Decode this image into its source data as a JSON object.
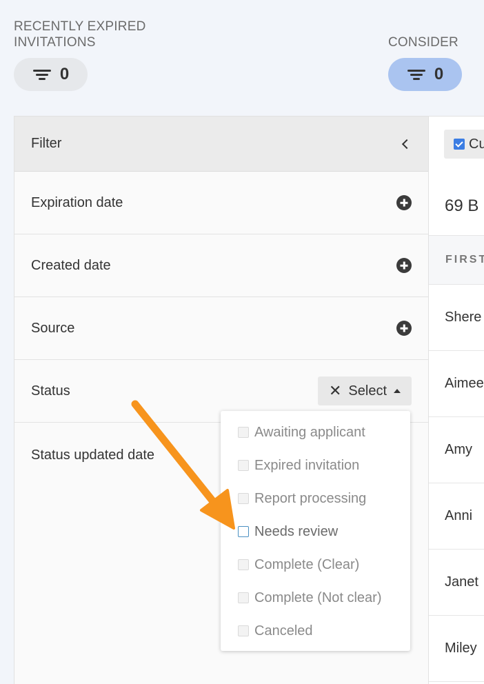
{
  "stats": [
    {
      "label": "RECENTLY EXPIRED INVITATIONS",
      "count": "0"
    },
    {
      "label": "CONSIDER",
      "count": "0"
    }
  ],
  "filter": {
    "title": "Filter",
    "rows": [
      {
        "label": "Expiration date"
      },
      {
        "label": "Created date"
      },
      {
        "label": "Source"
      },
      {
        "label": "Status",
        "select_label": "Select"
      },
      {
        "label": "Status updated date"
      }
    ]
  },
  "status_dropdown": {
    "options": [
      {
        "label": "Awaiting applicant",
        "checked": false
      },
      {
        "label": "Expired invitation",
        "checked": false
      },
      {
        "label": "Report processing",
        "checked": false
      },
      {
        "label": "Needs review",
        "checked": false
      },
      {
        "label": "Complete (Clear)",
        "checked": false
      },
      {
        "label": "Complete (Not clear)",
        "checked": false
      },
      {
        "label": "Canceled",
        "checked": false
      }
    ]
  },
  "results": {
    "checkbox_label": "Cu",
    "count_text": "69 B",
    "column_header": "FIRST",
    "first_names": [
      "Shere",
      "Aimee",
      "Amy",
      "Anni",
      "Janet",
      "Miley"
    ]
  },
  "colors": {
    "consider_pill": "#aac4f0",
    "annotation_arrow": "#f7941d",
    "accent": "#3b7de3"
  }
}
